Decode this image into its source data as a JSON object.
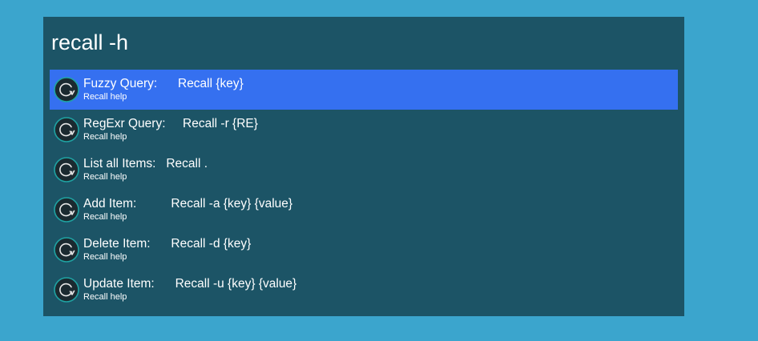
{
  "query": "recall -h",
  "results": [
    {
      "title": "Fuzzy Query:      Recall {key}",
      "subtitle": "Recall help",
      "icon": "refresh-icon",
      "selected": true
    },
    {
      "title": "RegExr Query:     Recall -r {RE}",
      "subtitle": "Recall help",
      "icon": "refresh-icon",
      "selected": false
    },
    {
      "title": "List all Items:   Recall .",
      "subtitle": "Recall help",
      "icon": "refresh-icon",
      "selected": false
    },
    {
      "title": "Add Item:          Recall -a {key} {value}",
      "subtitle": "Recall help",
      "icon": "refresh-icon",
      "selected": false
    },
    {
      "title": "Delete Item:      Recall -d {key}",
      "subtitle": "Recall help",
      "icon": "refresh-icon",
      "selected": false
    },
    {
      "title": "Update Item:      Recall -u {key} {value}",
      "subtitle": "Recall help",
      "icon": "refresh-icon",
      "selected": false
    }
  ],
  "colors": {
    "desktop": "#3ba5cd",
    "panel": "#1c5466",
    "selected": "#3570f0",
    "icon_ring": "#1fa3a3"
  }
}
